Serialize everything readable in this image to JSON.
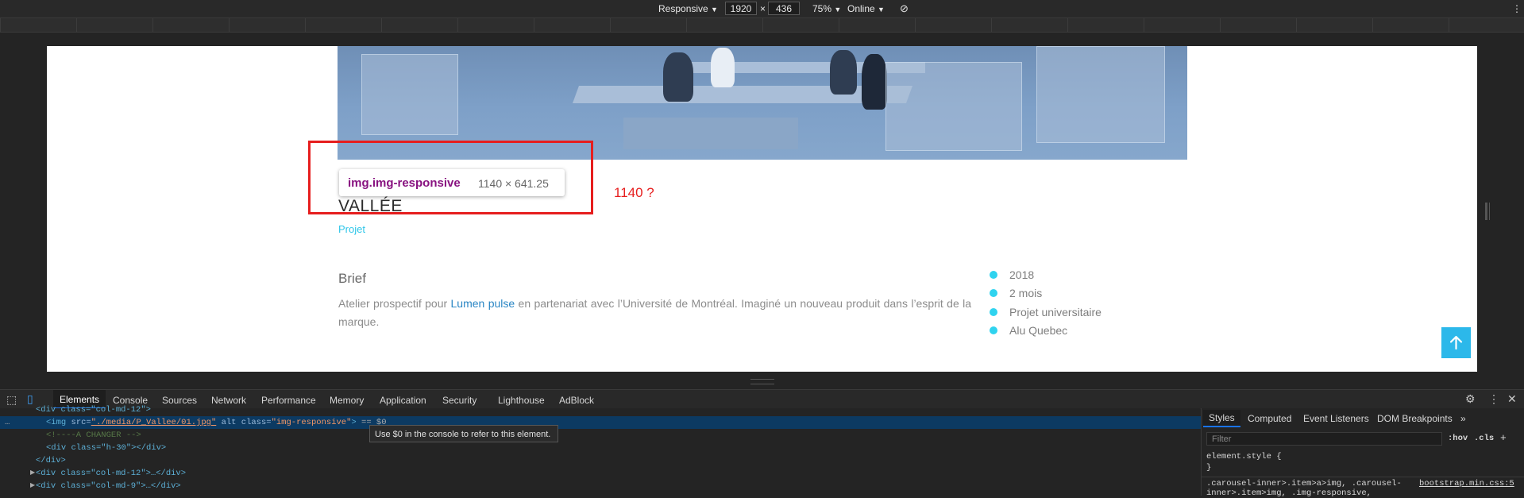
{
  "device_toolbar": {
    "mode": "Responsive",
    "width": "1920",
    "separator": "×",
    "height": "436",
    "zoom": "75%",
    "network": "Online"
  },
  "page": {
    "title": "VALLÉE",
    "category": "Projet",
    "brief_heading": "Brief",
    "brief_text_before": "Atelier prospectif pour ",
    "brief_link": "Lumen pulse",
    "brief_text_after": " en partenariat avec l’Université de Montréal. Imaginé un nouveau produit dans l’esprit de la marque.",
    "facts": [
      "2018",
      "2 mois",
      "Projet universitaire",
      "Alu Quebec"
    ],
    "to_top_icon": "arrow-up-icon"
  },
  "inspector_tooltip": {
    "selector": "img.img-responsive",
    "size": "1140 × 641.25"
  },
  "annotation": {
    "note": "1140 ?",
    "color": "#e61e1e"
  },
  "devtools": {
    "tabs": [
      "Elements",
      "Console",
      "Sources",
      "Network",
      "Performance",
      "Memory",
      "Application",
      "Security",
      "Lighthouse",
      "AdBlock"
    ],
    "active_tab": "Elements",
    "dom": {
      "line0": "<div class=\"col-md-12\">",
      "line1_tag_open": "<img ",
      "line1_src_attr": "src=",
      "line1_src_val": "\"./media/P_Vallee/01.jpg\"",
      "line1_rest": " alt class=",
      "line1_class_val": "\"img-responsive\"",
      "line1_close": ">",
      "line1_marker": " == $0",
      "line2": "<!----A CHANGER -->",
      "line3": "<div class=\"h-30\"></div>",
      "line4": "</div>",
      "line5": "<div class=\"col-md-12\">…</div>",
      "line6": "<div class=\"col-md-9\">…</div>",
      "ellipsis": "…"
    },
    "console_hint": "Use $0 in the console to refer to this element.",
    "styles_tabs": [
      "Styles",
      "Computed",
      "Event Listeners",
      "DOM Breakpoints"
    ],
    "more_tabs_icon": "double-chevron-right-icon",
    "filter_placeholder": "Filter",
    "hov": ":hov",
    "cls": ".cls",
    "plus": "+",
    "element_style_open": "element.style {",
    "element_style_close": "}",
    "rule_selector_line1": ".carousel-inner>.item>a>img, .carousel-",
    "rule_selector_line2": "inner>.item>img, .img-responsive,",
    "rule_source": "bootstrap.min.css:5"
  }
}
